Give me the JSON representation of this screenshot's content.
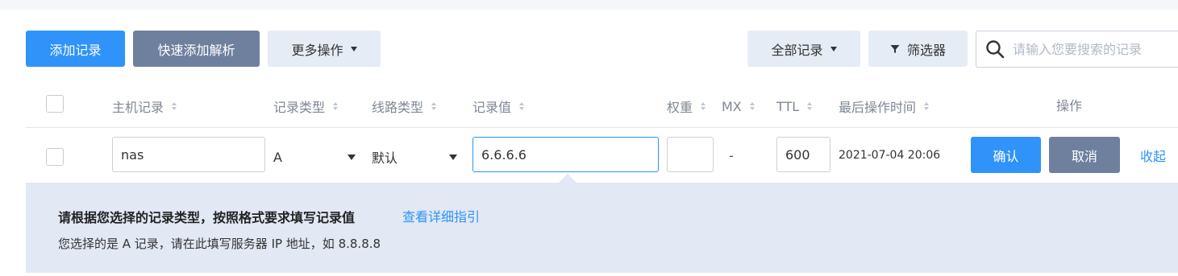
{
  "toolbar": {
    "add_record": "添加记录",
    "quick_add": "快速添加解析",
    "more_actions": "更多操作",
    "all_records": "全部记录",
    "filter": "筛选器"
  },
  "search": {
    "placeholder": "请输入您要搜索的记录",
    "icon": "search-icon"
  },
  "table": {
    "headers": {
      "host": "主机记录",
      "type": "记录类型",
      "line": "线路类型",
      "value": "记录值",
      "weight": "权重",
      "mx": "MX",
      "ttl": "TTL",
      "last_modified": "最后操作时间",
      "actions": "操作"
    },
    "edit_row": {
      "host": "nas",
      "type": "A",
      "line": "默认",
      "value": "6.6.6.6",
      "weight": "",
      "mx": "-",
      "ttl": "600",
      "last_modified": "2021-07-04 20:06",
      "confirm": "确认",
      "cancel": "取消",
      "collapse": "收起"
    }
  },
  "hint": {
    "title": "请根据您选择的记录类型，按照格式要求填写记录值",
    "guide_link": "查看详细指引",
    "description": "您选择的是 A 记录，请在此填写服务器 IP 地址，如 8.8.8.8"
  },
  "colors": {
    "primary": "#2f93f9",
    "secondary": "#6f809e",
    "light": "#e6ecf5",
    "panel": "#e2e8f4"
  }
}
